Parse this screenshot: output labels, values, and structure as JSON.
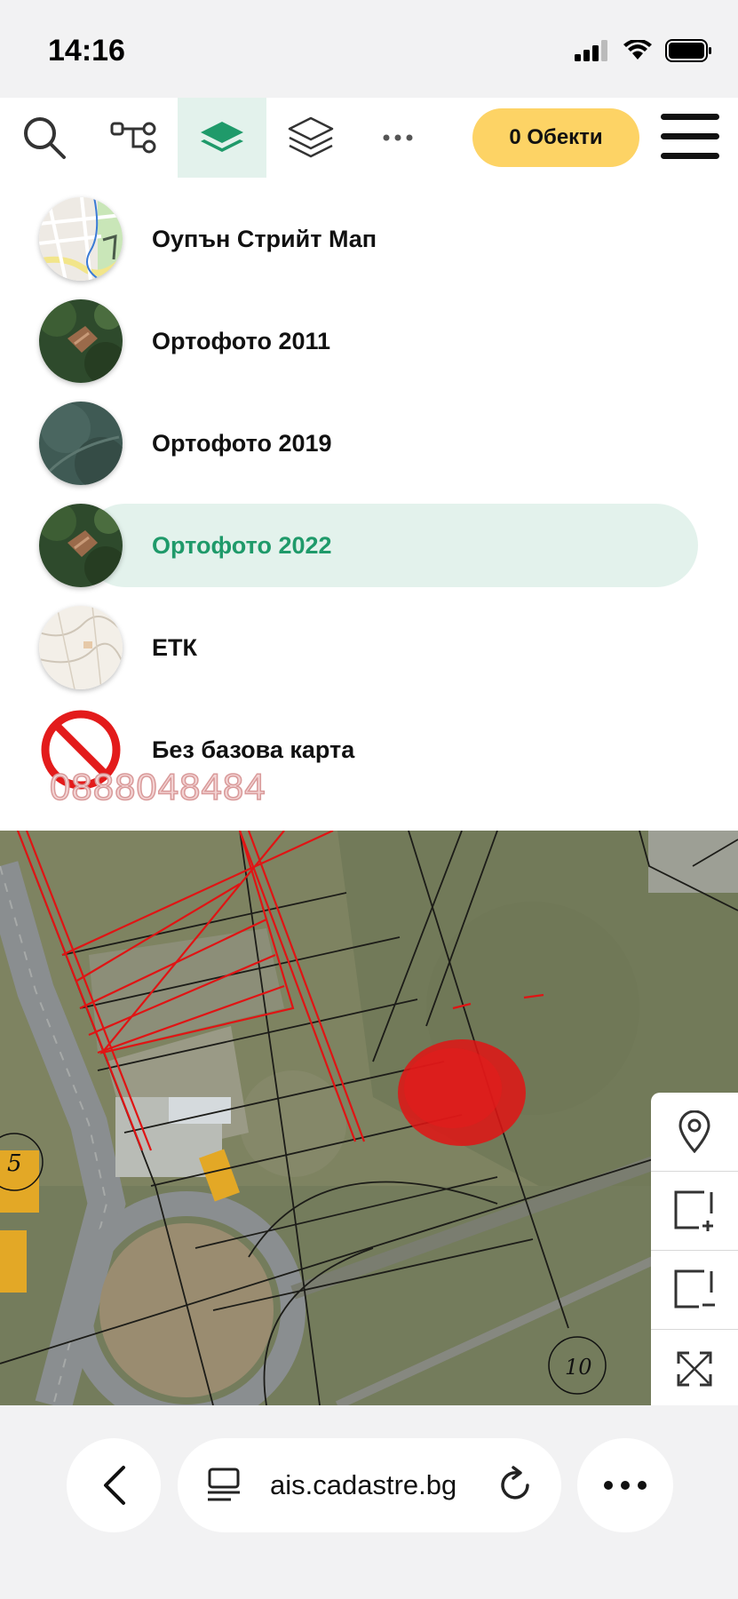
{
  "status_bar": {
    "time": "14:16"
  },
  "toolbar": {
    "objects_label": "0 Обекти"
  },
  "basemaps": [
    {
      "label": "Оупън Стрийт Мап",
      "selected": false,
      "thumb": "street-map"
    },
    {
      "label": "Ортофото 2011",
      "selected": false,
      "thumb": "orthophoto"
    },
    {
      "label": "Ортофото 2019",
      "selected": false,
      "thumb": "orthophoto-dark"
    },
    {
      "label": "Ортофото 2022",
      "selected": true,
      "thumb": "orthophoto"
    },
    {
      "label": "ЕТК",
      "selected": false,
      "thumb": "topo-map"
    },
    {
      "label": "Без базова карта",
      "selected": false,
      "thumb": "no-entry-icon"
    }
  ],
  "watermark": "0888048484",
  "map": {
    "labels": [
      "5",
      "10"
    ]
  },
  "browser": {
    "url": "ais.cadastre.bg"
  },
  "colors": {
    "accent": "#1f9a6a",
    "objects_button": "#fdd365",
    "selected_bg": "#e3f2ec",
    "parcel_highlight": "#e01414"
  }
}
